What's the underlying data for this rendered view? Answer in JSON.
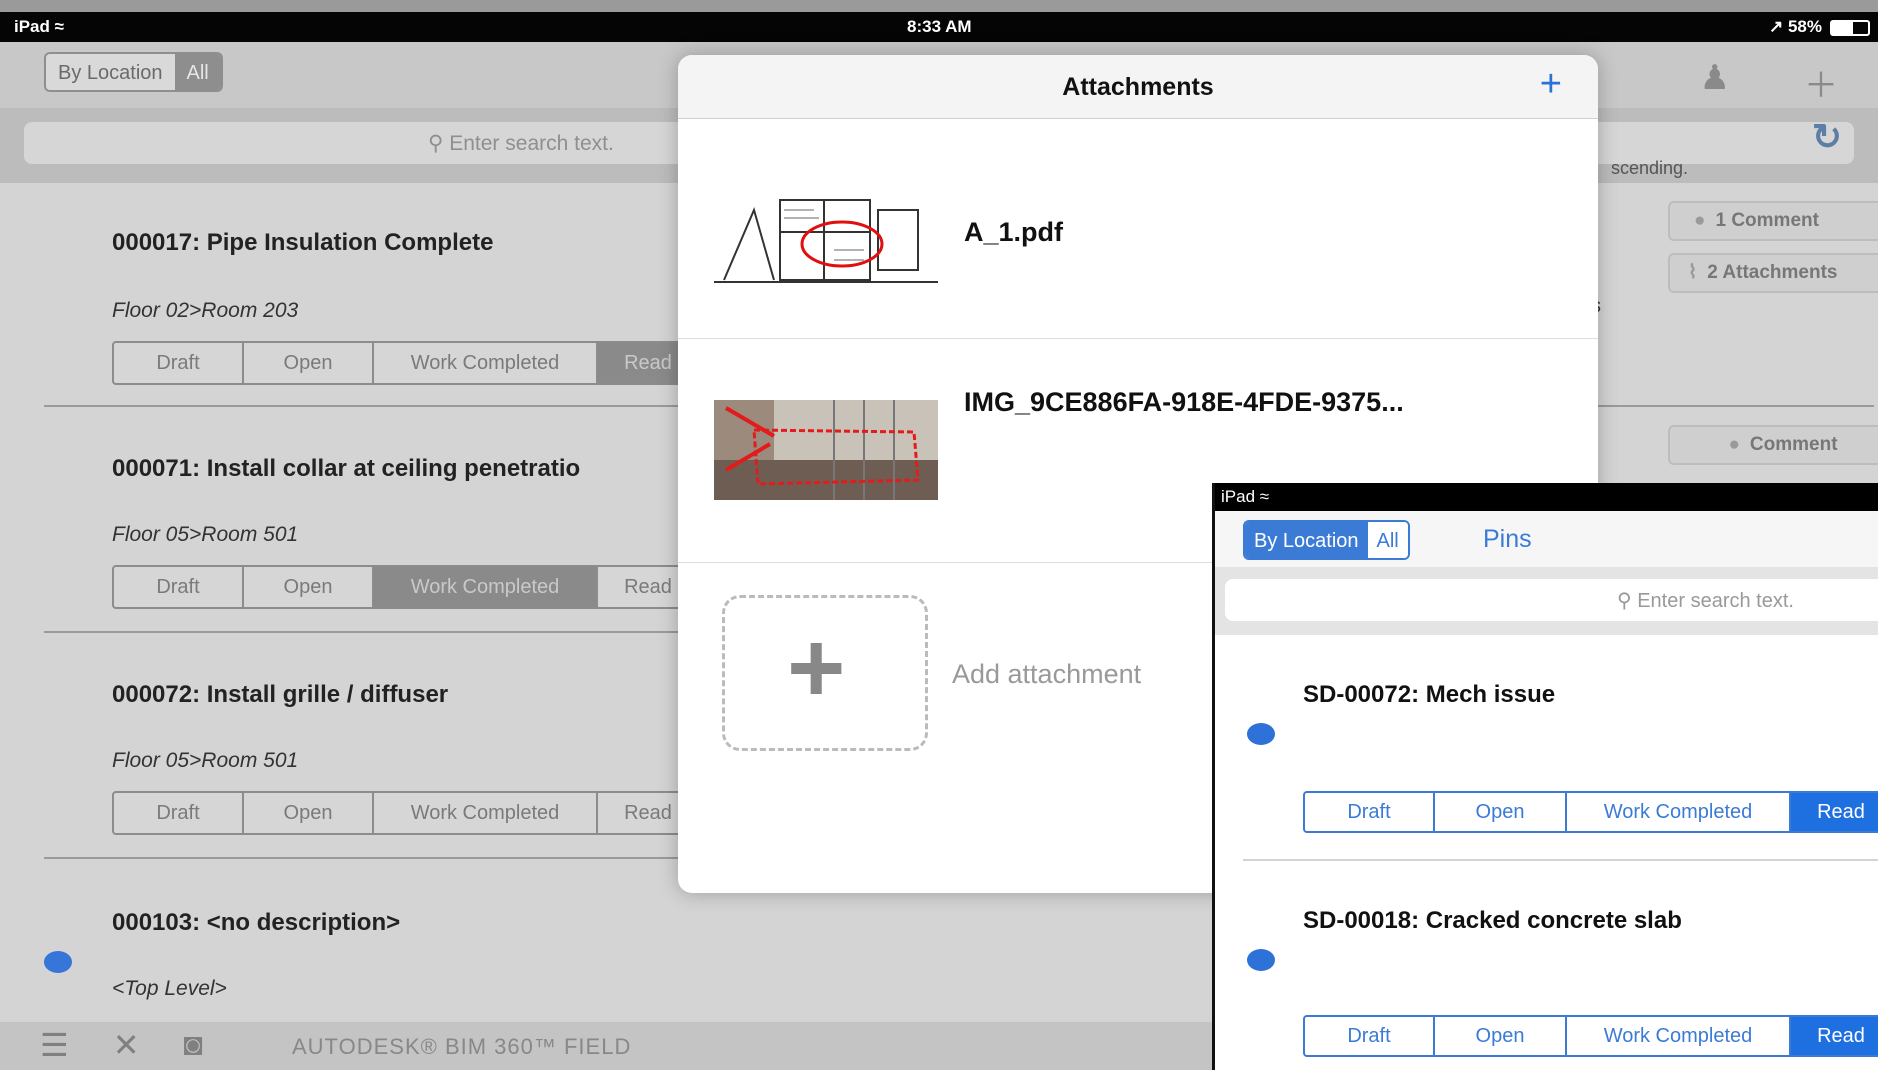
{
  "status_bar": {
    "device": "iPad",
    "time": "8:33 AM",
    "battery": "58%"
  },
  "navbar": {
    "segment": [
      "By Location",
      "All"
    ],
    "selected_segment": "All"
  },
  "search": {
    "placeholder": "Enter search text.",
    "sort_label": "scending."
  },
  "issues": [
    {
      "title": "000017: Pipe Insulation Complete",
      "location": "Floor 02>Room 203",
      "statuses": [
        "Draft",
        "Open",
        "Work Completed",
        "Read"
      ],
      "active_status": "Read",
      "comment_button": "1 Comment",
      "attachments_button": "2 Attachments",
      "extra_char": "s"
    },
    {
      "title": "000071: Install collar at ceiling penetratio",
      "location": "Floor 05>Room 501",
      "statuses": [
        "Draft",
        "Open",
        "Work Completed",
        "Read"
      ],
      "active_status": "Work Completed",
      "comment_button": "Comment"
    },
    {
      "title": "000072: Install grille / diffuser",
      "location": "Floor 05>Room 501",
      "statuses": [
        "Draft",
        "Open",
        "Work Completed",
        "Read"
      ],
      "active_status": ""
    },
    {
      "title": "000103: <no description>",
      "location": "<Top Level>"
    }
  ],
  "bottom_bar": {
    "brand": "AUTODESK® BIM 360™ FIELD",
    "icons": [
      "menu-icon",
      "tools-icon",
      "camera-icon"
    ]
  },
  "attachments_popover": {
    "title": "Attachments",
    "files": [
      {
        "name": "A_1.pdf",
        "thumb": "floor-plan"
      },
      {
        "name": "IMG_9CE886FA-918E-4FDE-9375...",
        "thumb": "photo"
      }
    ],
    "add_label": "Add attachment"
  },
  "inset_ipad": {
    "device": "iPad",
    "segment": [
      "By Location",
      "All"
    ],
    "selected_segment": "By Location",
    "pins_label": "Pins",
    "search_placeholder": "Enter search text.",
    "issues": [
      {
        "title": "SD-00072: Mech issue",
        "statuses": [
          "Draft",
          "Open",
          "Work Completed",
          "Read"
        ],
        "active_status": "Read"
      },
      {
        "title": "SD-00018: Cracked concrete slab",
        "statuses": [
          "Draft",
          "Open",
          "Work Completed",
          "Read"
        ],
        "active_status": "Read"
      }
    ]
  },
  "colors": {
    "accent_blue": "#2a72d8",
    "dot_blue": "#3576d8",
    "dim_gray": "#8a8a8a"
  }
}
